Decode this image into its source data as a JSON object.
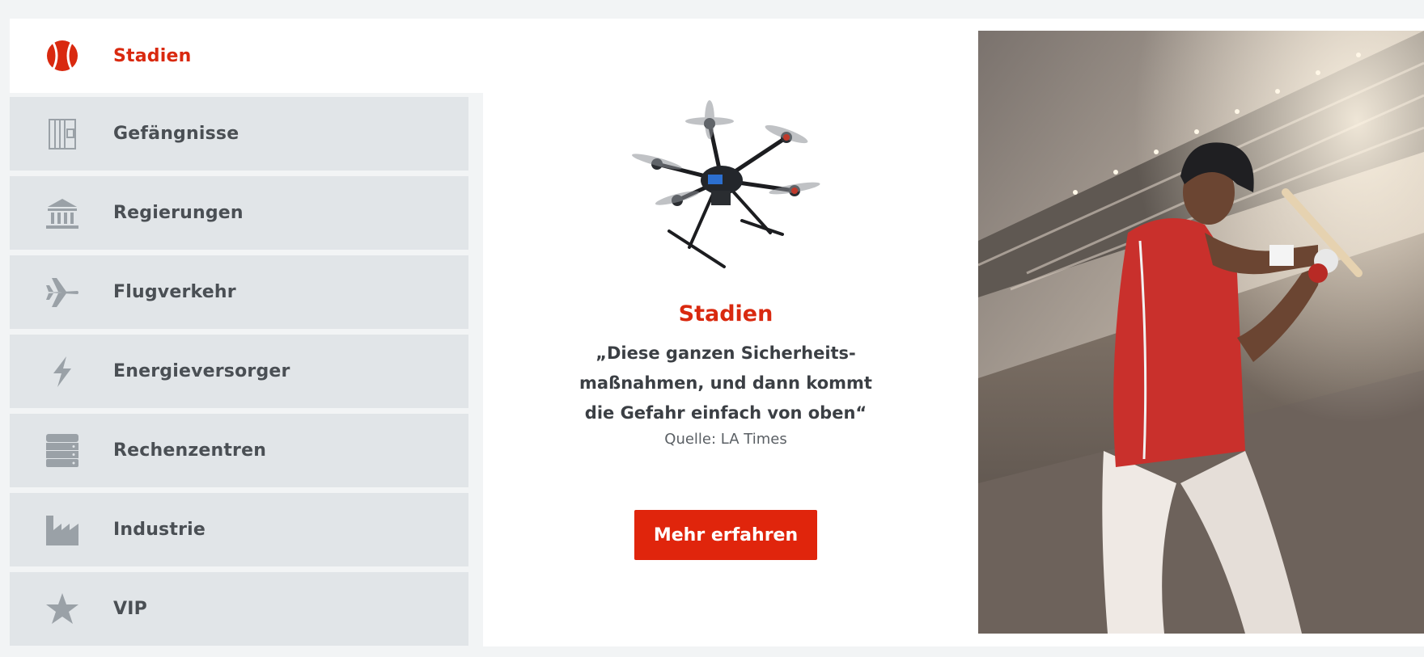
{
  "sidebar": {
    "items": [
      {
        "label": "Stadien",
        "icon": "baseball-icon",
        "active": true
      },
      {
        "label": "Gefängnisse",
        "icon": "prison-bars-icon",
        "active": false
      },
      {
        "label": "Regierungen",
        "icon": "government-building-icon",
        "active": false
      },
      {
        "label": "Flugverkehr",
        "icon": "airplane-icon",
        "active": false
      },
      {
        "label": "Energieversorger",
        "icon": "lightning-icon",
        "active": false
      },
      {
        "label": "Rechenzentren",
        "icon": "server-icon",
        "active": false
      },
      {
        "label": "Industrie",
        "icon": "factory-icon",
        "active": false
      },
      {
        "label": "VIP",
        "icon": "star-icon",
        "active": false
      }
    ]
  },
  "content": {
    "title": "Stadien",
    "quote_line1": "„Diese ganzen Sicherheits-",
    "quote_line2": "maßnahmen, und dann kommt",
    "quote_line3": "die Gefahr einfach von oben“",
    "source": "Quelle: LA Times",
    "cta_label": "Mehr erfahren"
  },
  "colors": {
    "accent": "#d9290f",
    "nav_bg": "#e1e5e8",
    "icon_grey": "#9aa1a7"
  }
}
